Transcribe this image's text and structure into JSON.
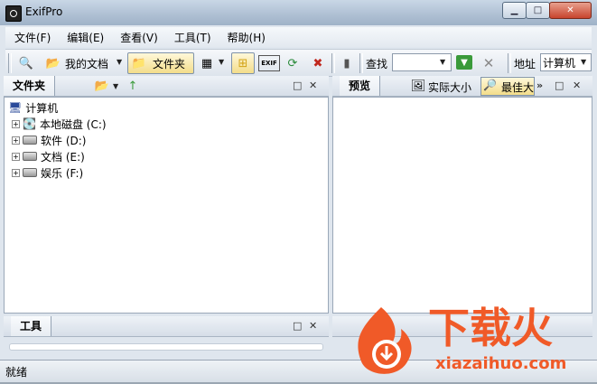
{
  "window": {
    "title": "ExifPro"
  },
  "menu": [
    "文件(F)",
    "编辑(E)",
    "查看(V)",
    "工具(T)",
    "帮助(H)"
  ],
  "toolbar": {
    "my_documents": "我的文档",
    "folders": "文件夹",
    "exif_label": "EXIF",
    "find_label": "查找",
    "address_label": "地址",
    "address_value": "计算机"
  },
  "folders_pane": {
    "title": "文件夹",
    "tree": {
      "root": "计算机",
      "drives": [
        "本地磁盘 (C:)",
        "软件 (D:)",
        "文档 (E:)",
        "娱乐 (F:)"
      ]
    }
  },
  "preview_pane": {
    "tabs": [
      "预览",
      "实际大小",
      "最佳大小"
    ]
  },
  "tools_pane": {
    "title": "工具"
  },
  "status": {
    "text": "就绪"
  },
  "watermark": {
    "brand": "下载火",
    "url": "xiazaihuo.com"
  },
  "colors": {
    "watermark_orange": "#f05a28",
    "title_gradient": "#aebfd3"
  }
}
